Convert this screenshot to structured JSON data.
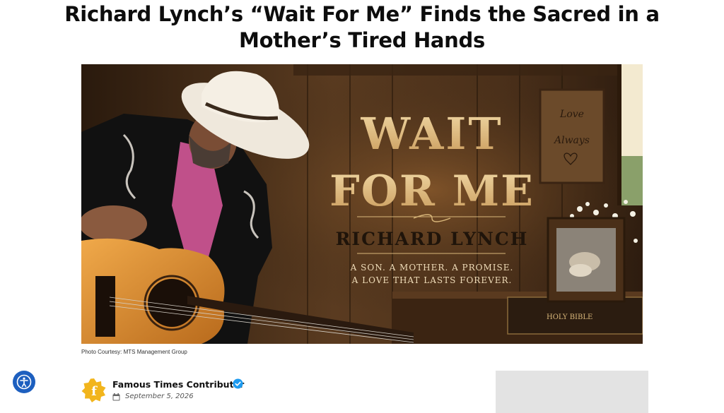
{
  "article": {
    "headline": "Richard Lynch’s “Wait For Me” Finds the Sacred in a Mother’s Tired Hands",
    "caption": "Photo Courtesy: MTS Management Group",
    "author": "Famous Times Contributor",
    "date": "September 5, 2026"
  },
  "hero": {
    "title_line1": "WAIT",
    "title_line2": "FOR ME",
    "artist": "RICHARD LYNCH",
    "tagline_line1": "A SON. A MOTHER. A PROMISE.",
    "tagline_line2": "A LOVE THAT LASTS FOREVER.",
    "sign_line1": "Love",
    "sign_line2": "Always",
    "bible_label": "HOLY BIBLE"
  },
  "icons": {
    "accessibility": "accessibility-icon",
    "author_logo": "famous-times-logo-icon",
    "verified": "verified-badge-icon",
    "calendar": "calendar-icon"
  },
  "colors": {
    "accessibility_bg": "#1d5fbf",
    "verified": "#1d9bf0",
    "logo_gold": "#f2b51c",
    "title_gold": "#e8c98c"
  }
}
